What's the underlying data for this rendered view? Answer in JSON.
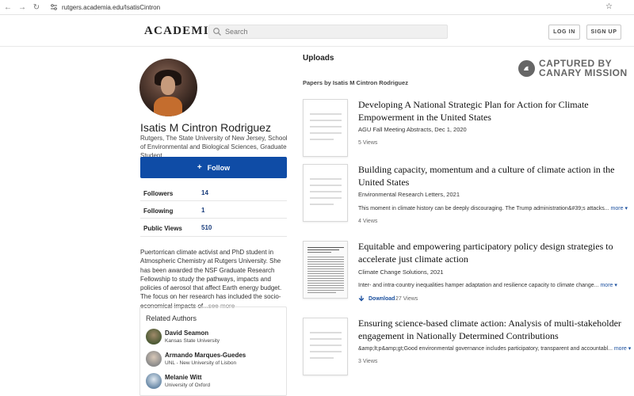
{
  "browser": {
    "url": "rutgers.academia.edu/IsatisCintron"
  },
  "header": {
    "logo": "ACADEMIA",
    "search_placeholder": "Search",
    "login_label": "LOG IN",
    "signup_label": "SIGN UP"
  },
  "profile": {
    "name": "Isatis M Cintron Rodriguez",
    "affiliation": "Rutgers, The State University of New Jersey, School of Environmental and Biological Sciences, Graduate Student",
    "follow_label": "Follow",
    "stats": [
      {
        "label": "Followers",
        "value": "14"
      },
      {
        "label": "Following",
        "value": "1"
      },
      {
        "label": "Public Views",
        "value": "510"
      }
    ],
    "bio": "Puertorrican climate activist and PhD student in Atmospheric Chemistry at Rutgers University. She has been awarded the NSF Graduate Research Fellowship to study the pathways, impacts and policies of aerosol that affect Earth energy budget. The focus on her research has included the socio-economical impacts of",
    "see_more": "...see more"
  },
  "related": {
    "title": "Related Authors",
    "authors": [
      {
        "name": "David Seamon",
        "institution": "Kansas State University"
      },
      {
        "name": "Armando Marques-Guedes",
        "institution": "UNL - New University of Lisbon"
      },
      {
        "name": "Melanie Witt",
        "institution": "University of Oxford"
      }
    ]
  },
  "uploads": {
    "title": "Uploads",
    "papers_by": "Papers by Isatis M Cintron Rodriguez",
    "watermark_line1": "CAPTURED BY",
    "watermark_line2": "CANARY MISSION",
    "papers": [
      {
        "title": "Developing A National Strategic Plan for Action for Climate Empowerment in the United States",
        "meta": "AGU Fall Meeting Abstracts, Dec 1, 2020",
        "snippet": "",
        "views": "5 Views"
      },
      {
        "title": "Building capacity, momentum and a culture of climate action in the United States",
        "meta": "Environmental Research Letters, 2021",
        "snippet": "This moment in climate history can be deeply discouraging. The Trump administration&#39;s attacks...",
        "more": "more",
        "views": "4 Views"
      },
      {
        "title": "Equitable and empowering participatory policy design strategies to accelerate just climate action",
        "meta": "Climate Change Solutions, 2021",
        "snippet": "Inter- and intra-country inequalities hamper adaptation and resilience capacity to climate change...",
        "more": "more",
        "download": "Download",
        "views": "27 Views"
      },
      {
        "title": "Ensuring science-based climate action: Analysis of multi-stakeholder engagement in Nationally Determined Contributions",
        "meta": "",
        "snippet": "&amp;lt;p&amp;gt;Good environmental governance includes participatory, transparent and accountabl...",
        "more": "more",
        "views": "3 Views"
      }
    ]
  }
}
